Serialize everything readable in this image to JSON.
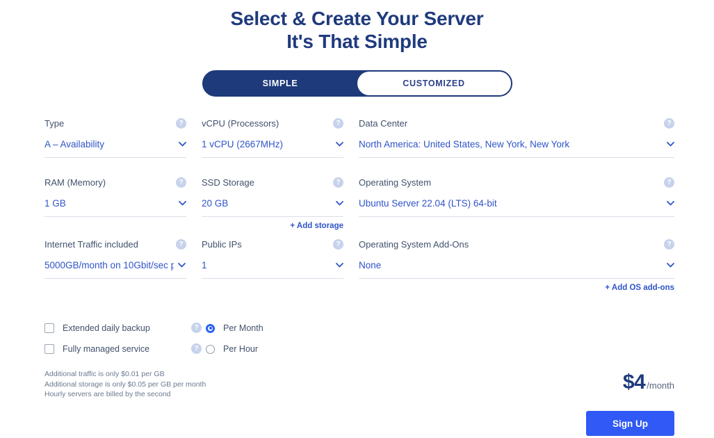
{
  "header": {
    "title_line1": "Select & Create Your Server",
    "title_line2": "It's That Simple"
  },
  "toggle": {
    "simple_label": "SIMPLE",
    "customized_label": "CUSTOMIZED",
    "active": "SIMPLE"
  },
  "help_icon": "?",
  "fields": {
    "type": {
      "label": "Type",
      "value": "A – Availability"
    },
    "vcpu": {
      "label": "vCPU (Processors)",
      "value": "1 vCPU (2667MHz)"
    },
    "data_center": {
      "label": "Data Center",
      "value": "North America: United States, New York, New York"
    },
    "ram": {
      "label": "RAM (Memory)",
      "value": "1 GB"
    },
    "ssd": {
      "label": "SSD Storage",
      "value": "20 GB"
    },
    "os": {
      "label": "Operating System",
      "value": "Ubuntu Server 22.04 (LTS) 64-bit"
    },
    "traffic": {
      "label": "Internet Traffic included",
      "value": "5000GB/month on 10Gbit/sec p"
    },
    "public_ips": {
      "label": "Public IPs",
      "value": "1"
    },
    "os_addons": {
      "label": "Operating System Add-Ons",
      "value": "None"
    }
  },
  "links": {
    "add_storage": "+ Add storage",
    "add_os_addons": "+ Add OS add-ons"
  },
  "options": {
    "checkboxes": [
      {
        "label": "Extended daily backup",
        "checked": false
      },
      {
        "label": "Fully managed service",
        "checked": false
      }
    ],
    "radios": [
      {
        "label": "Per Month",
        "checked": true
      },
      {
        "label": "Per Hour",
        "checked": false
      }
    ]
  },
  "fine_print": [
    "Additional traffic is only $0.01 per GB",
    "Additional storage is only $0.05 per GB per month",
    "Hourly servers are billed by the second"
  ],
  "price": {
    "amount": "$4",
    "period": "/month"
  },
  "cta": {
    "label": "Sign Up"
  },
  "colors": {
    "navy": "#1f3a7d",
    "toggle_bg": "#1e3a7b",
    "link_blue": "#2f54c8",
    "cta_blue": "#3059f5",
    "radio_blue": "#2962f6",
    "help_grey": "#c7d2ec"
  }
}
